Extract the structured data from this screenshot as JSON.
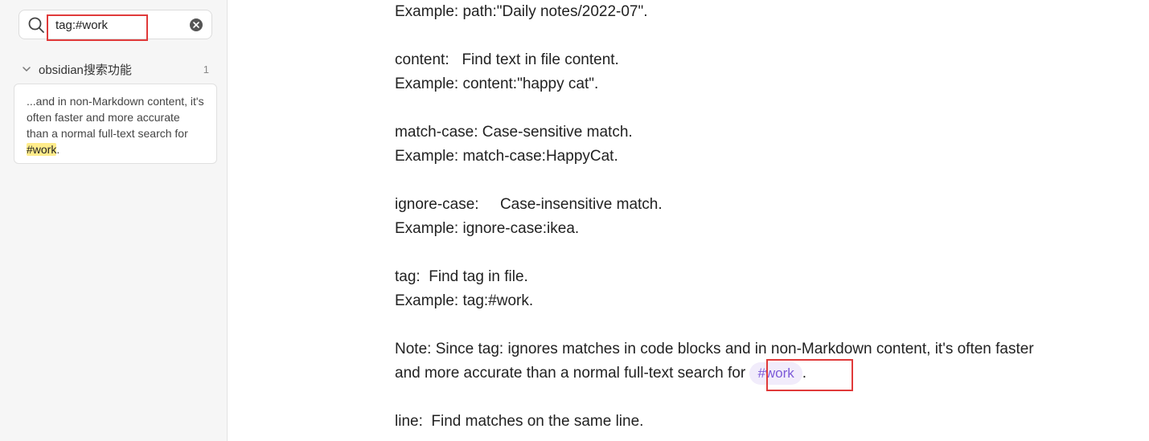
{
  "sidebar": {
    "search": {
      "value": "tag:#work",
      "placeholder": ""
    },
    "results": {
      "group_title": "obsidian搜索功能",
      "count": "1",
      "snippet_before": "...and in non-Markdown content, it's often faster and more accurate than a normal full-text search for ",
      "snippet_match": "#work",
      "snippet_after": "."
    }
  },
  "document": {
    "lines": {
      "path_example": "Example: path:\"Daily notes/2022-07\".",
      "content_desc": "content:   Find text in file content.",
      "content_example": "Example: content:\"happy cat\".",
      "match_case_desc": "match-case: Case-sensitive match.",
      "match_case_example": "Example: match-case:HappyCat.",
      "ignore_case_desc": "ignore-case:     Case-insensitive match.",
      "ignore_case_example": "Example: ignore-case:ikea.",
      "tag_desc": "tag:  Find tag in file.",
      "tag_example": "Example: tag:#work.",
      "note_line1": "Note: Since tag: ignores matches in code blocks and in non-Markdown content, it's often faster",
      "note_line2_before": "and more accurate than a normal full-text search for ",
      "note_tag": "#work",
      "note_line2_after": ".",
      "line_desc": "line:  Find matches on the same line."
    }
  },
  "colors": {
    "highlight_border": "#e03a3a",
    "tag_text": "#7c5ad8",
    "tag_bg": "#f1ecfb",
    "match_bg": "#ffec8b"
  }
}
